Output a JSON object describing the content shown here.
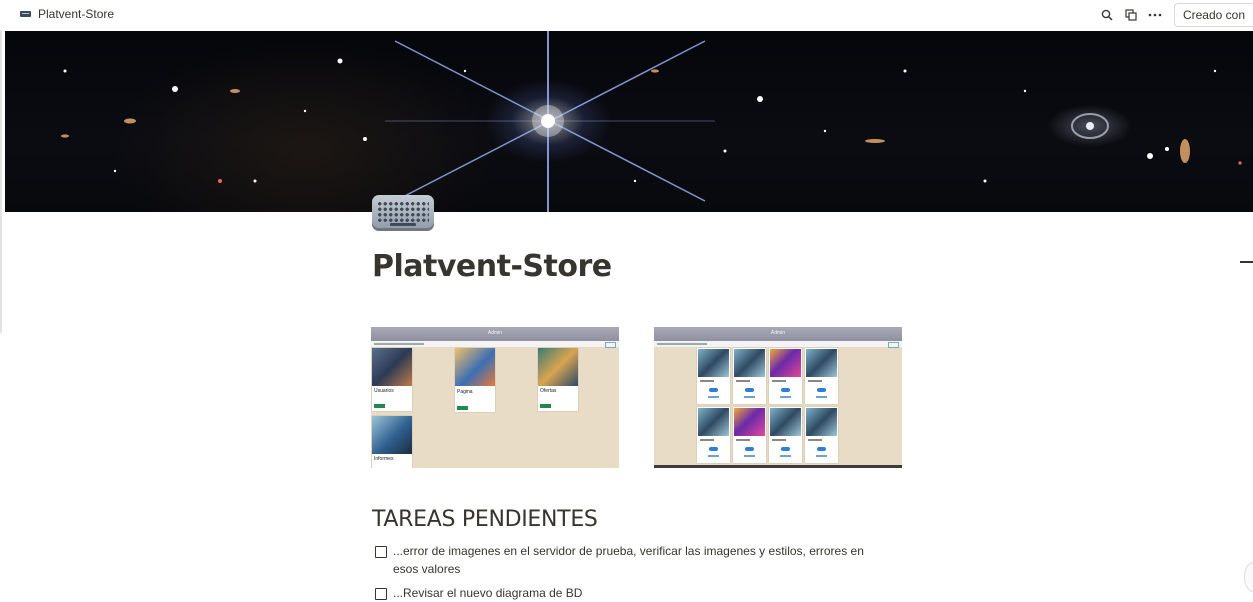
{
  "topbar": {
    "breadcrumb": "Platvent-Store",
    "breadcrumb_icon": "keyboard-icon",
    "search_icon": "search-icon",
    "duplicate_icon": "copy-icon",
    "more_icon": "more-horizontal-icon",
    "created_button": "Creado con"
  },
  "page": {
    "icon": "keyboard-icon",
    "title": "Platvent-Store"
  },
  "screenshots": [
    {
      "header": "Admin",
      "cards": [
        {
          "title": "Usuarios"
        },
        {
          "title": "Pagina"
        },
        {
          "title": "Ofertas"
        },
        {
          "title": "Informes"
        }
      ]
    },
    {
      "header": "Admin"
    }
  ],
  "section": {
    "heading": "TAREAS PENDIENTES"
  },
  "todos": [
    {
      "text": "...error de imagenes en el servidor de prueba, verificar las imagenes y estilos, errores en esos valores",
      "checked": false
    },
    {
      "text": "...Revisar el nuevo diagrama de BD",
      "checked": false
    }
  ],
  "colors": {
    "text": "#37352f",
    "admin_header": "#9c9cab",
    "screenshot_bg": "#e8dcc6",
    "green_button": "#1f8a4c"
  }
}
